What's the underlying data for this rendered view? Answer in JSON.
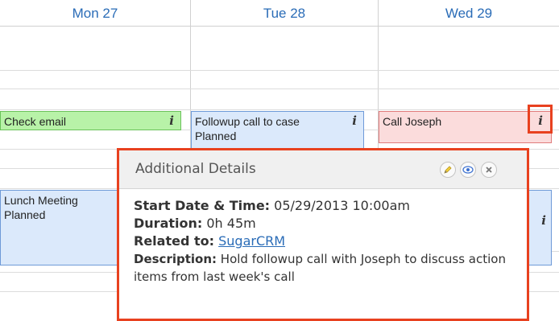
{
  "calendar": {
    "days": [
      "Mon 27",
      "Tue 28",
      "Wed 29"
    ],
    "events": {
      "check_email": "Check email",
      "followup_line1": "Followup call to case",
      "followup_line2": "Planned",
      "call_joseph": "Call Joseph",
      "lunch_line1": "Lunch Meeting",
      "lunch_line2": "Planned",
      "info_glyph": "i"
    }
  },
  "popup": {
    "title": "Additional Details",
    "start_label": "Start Date & Time:",
    "start_value": "05/29/2013 10:00am",
    "duration_label": "Duration:",
    "duration_value": "0h 45m",
    "related_label": "Related to:",
    "related_value": "SugarCRM",
    "description_label": "Description:",
    "description_value": "Hold followup call with Joseph to discuss action items from last week's call",
    "buttons": [
      "edit-icon",
      "view-icon",
      "close-icon"
    ]
  },
  "colors": {
    "accent": "#2a6cb7",
    "highlight": "#e8411f",
    "green_event": "#b8f2a8",
    "blue_event": "#dbe9fb",
    "red_event": "#fbdcdc"
  }
}
